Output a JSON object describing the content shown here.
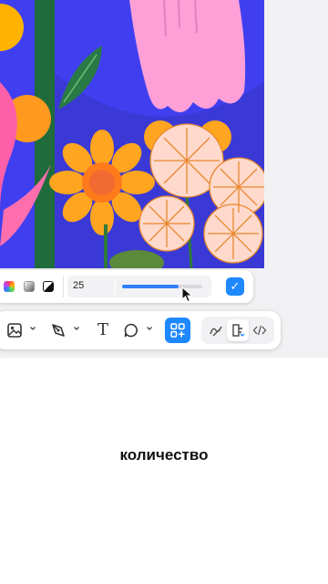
{
  "color_toolbar": {
    "fill_options": [
      {
        "name": "gradient-swatch-icon"
      },
      {
        "name": "linear-gradient-swatch-icon"
      },
      {
        "name": "contrast-swatch-icon"
      }
    ],
    "value_label": "25",
    "slider_level": 0.7,
    "accent_color": "#1e88ff",
    "confirm_icon": "checkmark-icon"
  },
  "tools_toolbar": {
    "tools": [
      "image-icon",
      "pen-icon",
      "text-icon",
      "comment-icon",
      "shapes-icon"
    ],
    "text_tool_glyph": "T",
    "right_tools": [
      "draw-icon",
      "dev-mode-icon",
      "code-icon"
    ]
  },
  "caption": "количество"
}
